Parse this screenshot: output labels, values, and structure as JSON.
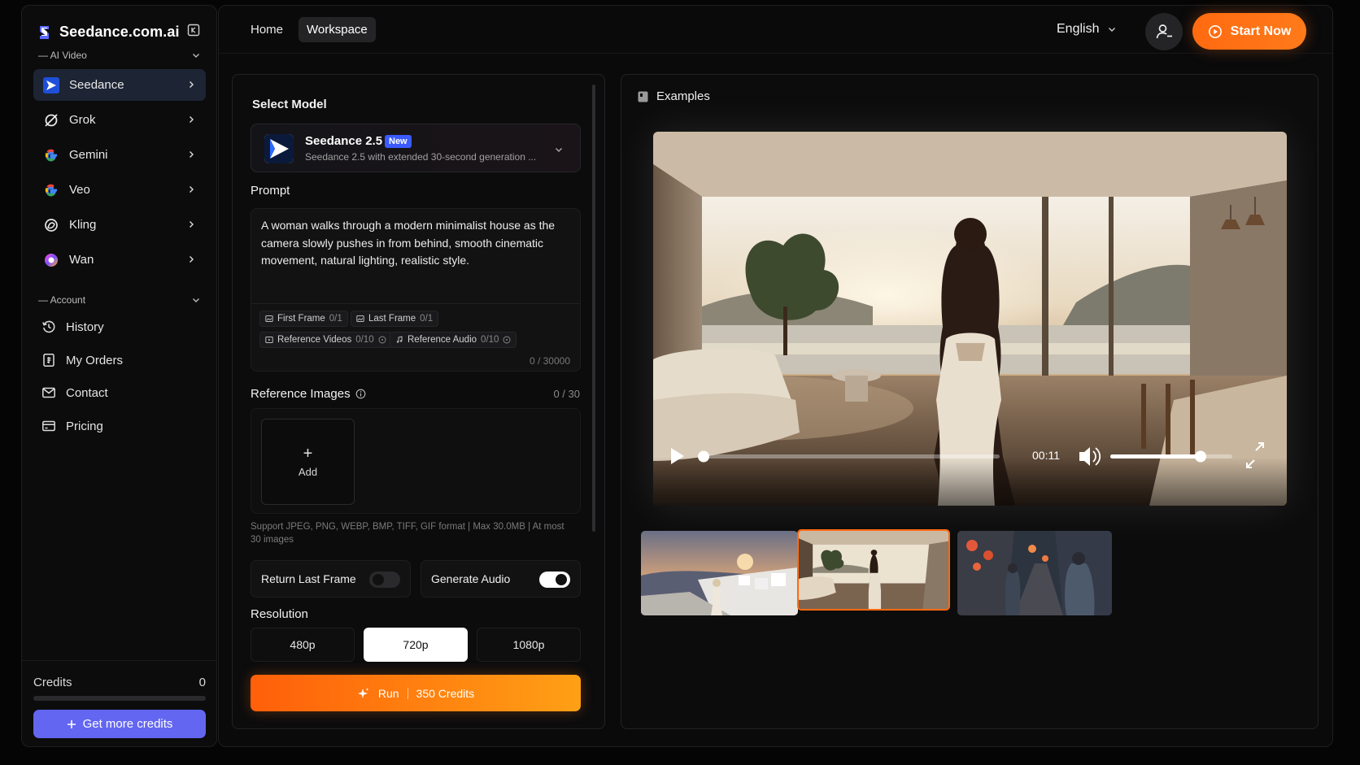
{
  "brand": {
    "name": "Seedance.com.ai"
  },
  "sidebar": {
    "ai_video_header": "— AI Video",
    "models": [
      {
        "label": "Seedance"
      },
      {
        "label": "Grok"
      },
      {
        "label": "Gemini"
      },
      {
        "label": "Veo"
      },
      {
        "label": "Kling"
      },
      {
        "label": "Wan"
      }
    ],
    "account_header": "— Account",
    "account_items": [
      {
        "label": "History"
      },
      {
        "label": "My Orders"
      },
      {
        "label": "Contact"
      },
      {
        "label": "Pricing"
      }
    ],
    "credits_label": "Credits",
    "credits_value": "0",
    "credits_progress": 0,
    "get_credits_label": "Get more credits"
  },
  "header": {
    "tabs": [
      {
        "label": "Home"
      },
      {
        "label": "Workspace"
      }
    ],
    "active_tab": "Workspace",
    "language": "English",
    "start_label": "Start Now"
  },
  "form": {
    "select_model_label": "Select Model",
    "model": {
      "name": "Seedance 2.5",
      "badge": "New",
      "description": "Seedance 2.5 with extended 30-second generation ..."
    },
    "prompt_label": "Prompt",
    "prompt_text": "A woman walks through a modern minimalist house as the camera slowly pushes in from behind, smooth cinematic movement, natural lighting, realistic style.",
    "chips": [
      {
        "label": "First Frame",
        "count": "0/1"
      },
      {
        "label": "Last Frame",
        "count": "0/1"
      },
      {
        "label": "Reference Videos",
        "count": "0/10"
      },
      {
        "label": "Reference Audio",
        "count": "0/10"
      }
    ],
    "char_count": "0 / 30000",
    "ref_images_label": "Reference Images",
    "ref_images_count": "0 / 30",
    "add_label": "Add",
    "support_text": "Support JPEG,  PNG,  WEBP,  BMP,  TIFF,  GIF format | Max 30.0MB | At most 30 images",
    "return_last_frame_label": "Return Last Frame",
    "return_last_frame_on": false,
    "generate_audio_label": "Generate Audio",
    "generate_audio_on": true,
    "resolution_label": "Resolution",
    "resolutions": [
      "480p",
      "720p",
      "1080p"
    ],
    "selected_resolution": "720p",
    "run_label": "Run",
    "run_cost": "350 Credits"
  },
  "examples": {
    "title": "Examples",
    "video_time": "00:11",
    "playback_progress": 0.0,
    "volume_level": 0.74,
    "selected_thumbnail": 2
  },
  "colors": {
    "accent_orange": "#ff6a10",
    "credits_button": "#6366f1",
    "new_badge": "#3b5bff",
    "active_nav": "#1d2434"
  }
}
